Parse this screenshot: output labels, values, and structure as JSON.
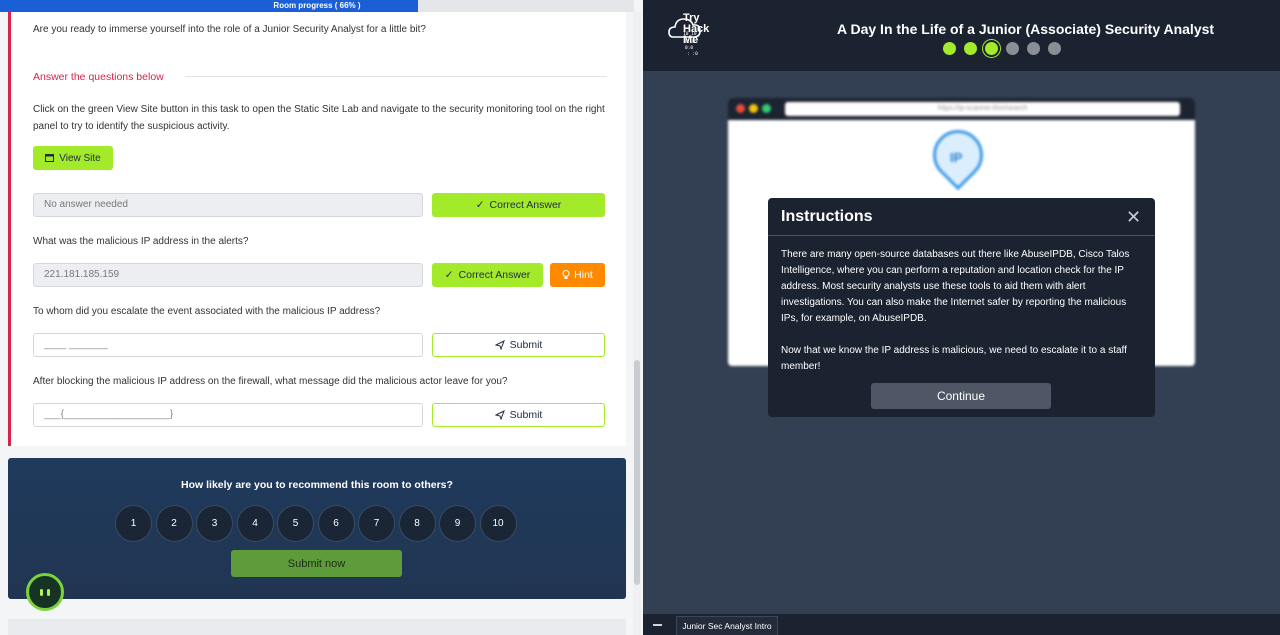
{
  "progress": {
    "label": "Room progress ( 66% )",
    "percent": 66
  },
  "task": {
    "intro": "Are you ready to immerse yourself into the role of a Junior Security Analyst for a little bit?",
    "answer_heading": "Answer the questions below",
    "q1": "Click on the green View Site button in this task to open the Static Site Lab and navigate to the security monitoring tool on the right panel to try to identify the suspicious activity.",
    "view_site_label": "View Site",
    "a1_value": "No answer needed",
    "correct_label": "Correct Answer",
    "q2": "What was the malicious IP address in the alerts?",
    "a2_value": "221.181.185.159",
    "hint_label": "Hint",
    "q3": "To whom did you escalate the event associated with the malicious IP address?",
    "a3_placeholder": "____ _______",
    "submit_label": "Submit",
    "q4": "After blocking the malicious IP address on the firewall, what message did the malicious actor leave for you?",
    "a4_placeholder": "___{___________________}"
  },
  "rating": {
    "question": "How likely are you to recommend this room to others?",
    "options": [
      "1",
      "2",
      "3",
      "4",
      "5",
      "6",
      "7",
      "8",
      "9",
      "10"
    ],
    "submit_label": "Submit now"
  },
  "right": {
    "logo_text": [
      "Try",
      "Hack",
      "Me"
    ],
    "title": "A Day In the Life of a Junior (Associate) Security Analyst",
    "steps": [
      "done",
      "done",
      "current",
      "pending",
      "pending",
      "pending"
    ],
    "browser_url": "https://ip-scanner.thm/search",
    "modal_title": "Instructions",
    "modal_p1": "There are many open-source databases out there like AbuseIPDB, Cisco Talos Intelligence, where you can perform a reputation and location check for the IP address. Most security analysts use these tools to aid them with alert investigations. You can also make the Internet safer by reporting the malicious IPs, for example, on AbuseIPDB.",
    "modal_p2": "Now that we know the IP address is malicious, we need to escalate it to a staff member!",
    "continue_label": "Continue",
    "taskbar_tab": "Junior Sec Analyst Intro"
  },
  "colors": {
    "accent_green": "#a3ea2a",
    "accent_red": "#d8234a",
    "hint_orange": "#ff8a00",
    "progress_blue": "#1a5fd6"
  }
}
